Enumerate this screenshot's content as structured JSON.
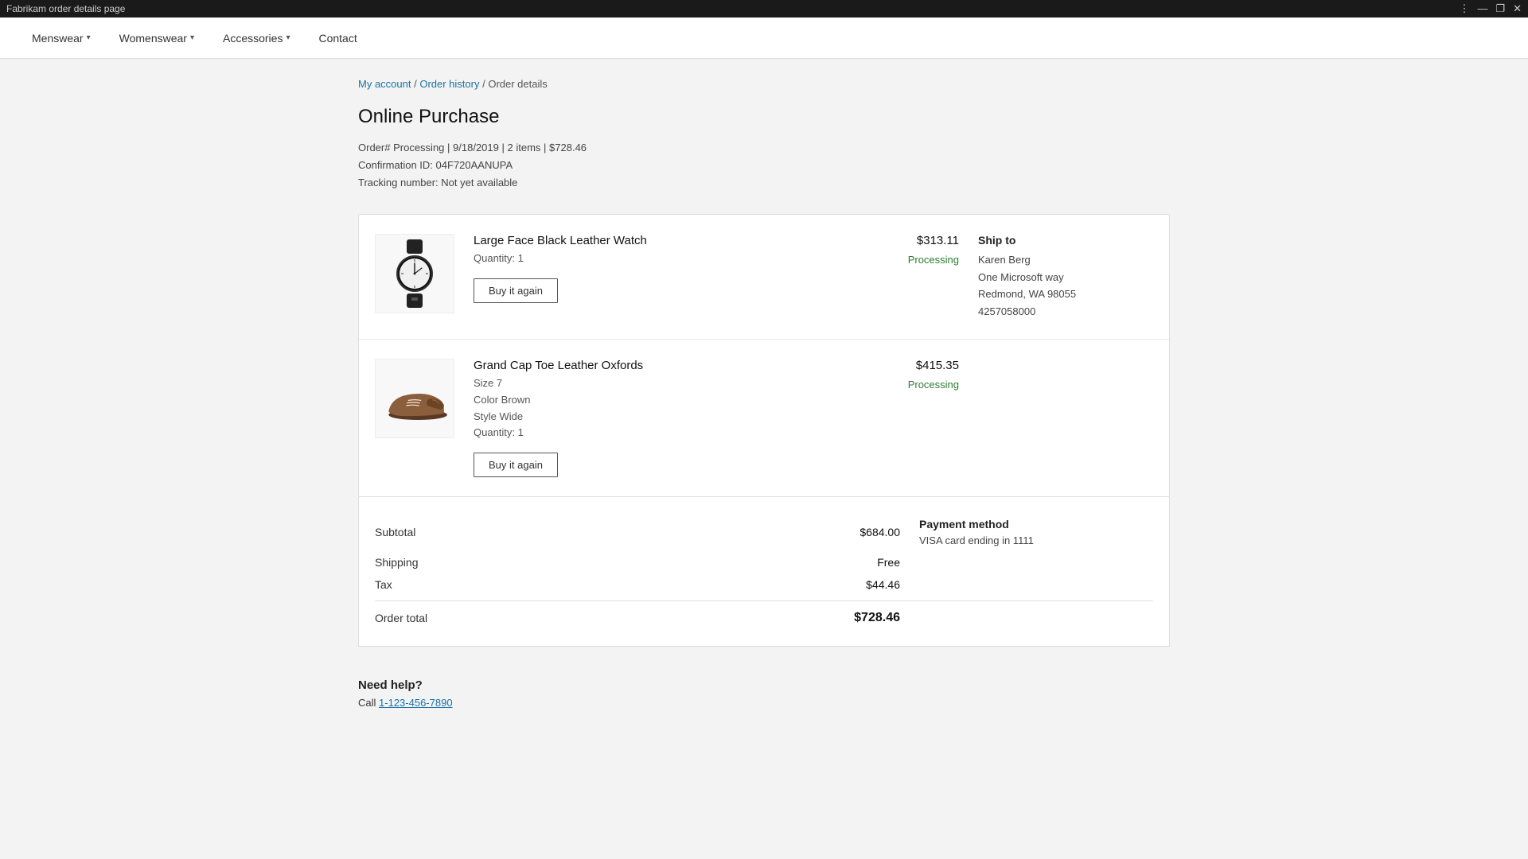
{
  "titlebar": {
    "title": "Fabrikam order details page",
    "menu_icon": "⋮",
    "minimize": "—",
    "restore": "❐",
    "close": "✕"
  },
  "nav": {
    "items": [
      {
        "id": "menswear",
        "label": "Menswear",
        "has_dropdown": true
      },
      {
        "id": "womenswear",
        "label": "Womenswear",
        "has_dropdown": true
      },
      {
        "id": "accessories",
        "label": "Accessories",
        "has_dropdown": true
      },
      {
        "id": "contact",
        "label": "Contact",
        "has_dropdown": false
      }
    ]
  },
  "breadcrumb": {
    "my_account": "My account",
    "order_history": "Order history",
    "current": "Order details"
  },
  "page": {
    "title": "Online Purchase",
    "order_meta": {
      "order_number_label": "Order#",
      "status": "Processing",
      "date": "9/18/2019",
      "items_count": "2 items",
      "total": "$728.46",
      "confirmation_label": "Confirmation ID:",
      "confirmation_id": "04F720AANUPA",
      "tracking_label": "Tracking number:",
      "tracking_value": "Not yet available"
    },
    "items": [
      {
        "id": "item-1",
        "name": "Large Face Black Leather Watch",
        "attrs": [
          {
            "label": "Quantity:",
            "value": "1"
          }
        ],
        "price": "$313.11",
        "status": "Processing",
        "buy_again_label": "Buy it again",
        "image_type": "watch"
      },
      {
        "id": "item-2",
        "name": "Grand Cap Toe Leather Oxfords",
        "attrs": [
          {
            "label": "Size",
            "value": "7"
          },
          {
            "label": "Color",
            "value": "Brown"
          },
          {
            "label": "Style",
            "value": "Wide"
          },
          {
            "label": "Quantity:",
            "value": "1"
          }
        ],
        "price": "$415.35",
        "status": "Processing",
        "buy_again_label": "Buy it again",
        "image_type": "shoe"
      }
    ],
    "ship_to": {
      "label": "Ship to",
      "name": "Karen Berg",
      "address_line1": "One Microsoft way",
      "address_line2": "Redmond, WA 98055",
      "phone": "4257058000"
    },
    "totals": {
      "subtotal_label": "Subtotal",
      "subtotal_value": "$684.00",
      "shipping_label": "Shipping",
      "shipping_value": "Free",
      "tax_label": "Tax",
      "tax_value": "$44.46",
      "order_total_label": "Order total",
      "order_total_value": "$728.46"
    },
    "payment": {
      "label": "Payment method",
      "value": "VISA card ending in 1111"
    },
    "help": {
      "title": "Need help?",
      "call_text": "Call",
      "phone": "1-123-456-7890"
    }
  }
}
